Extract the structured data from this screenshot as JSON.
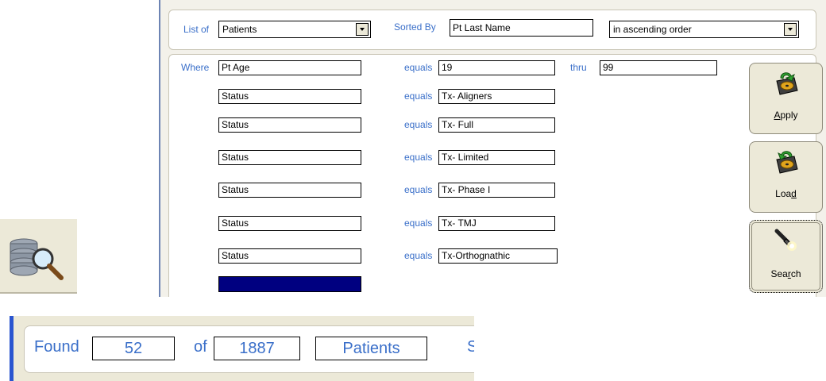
{
  "list_of": {
    "label": "List of",
    "value": "Patients"
  },
  "sorted_by": {
    "label": "Sorted By",
    "value": "Pt Last Name",
    "order": "in ascending order"
  },
  "criteria": {
    "where_label": "Where",
    "thru_label": "thru",
    "first": {
      "field": "Pt Age",
      "op": "equals",
      "value": "19",
      "thru_value": "99"
    },
    "rows": [
      {
        "field": "Status",
        "op": "equals",
        "value": "Tx- Aligners"
      },
      {
        "field": "Status",
        "op": "equals",
        "value": "Tx- Full"
      },
      {
        "field": "Status",
        "op": "equals",
        "value": "Tx- Limited"
      },
      {
        "field": "Status",
        "op": "equals",
        "value": "Tx- Phase I"
      },
      {
        "field": "Status",
        "op": "equals",
        "value": "Tx- TMJ"
      },
      {
        "field": "Status",
        "op": "equals",
        "value": "Tx-Orthognathic"
      }
    ],
    "selected_row_color": "#000080"
  },
  "buttons": {
    "apply": {
      "pre": "",
      "key": "A",
      "post": "pply"
    },
    "load": {
      "pre": "Loa",
      "key": "d",
      "post": ""
    },
    "search": {
      "pre": "Sea",
      "key": "r",
      "post": "ch"
    }
  },
  "found": {
    "label": "Found",
    "count": "52",
    "of_label": "of",
    "total": "1887",
    "entity": "Patients",
    "clipped_char": "S"
  },
  "icons": [
    "database-search-icon",
    "disk-apply-icon",
    "disk-load-icon",
    "flashlight-icon"
  ],
  "colors": {
    "label_blue": "#3a6fc9",
    "bar_accent": "#2a55d0",
    "panel_bg": "#ece9d8"
  }
}
